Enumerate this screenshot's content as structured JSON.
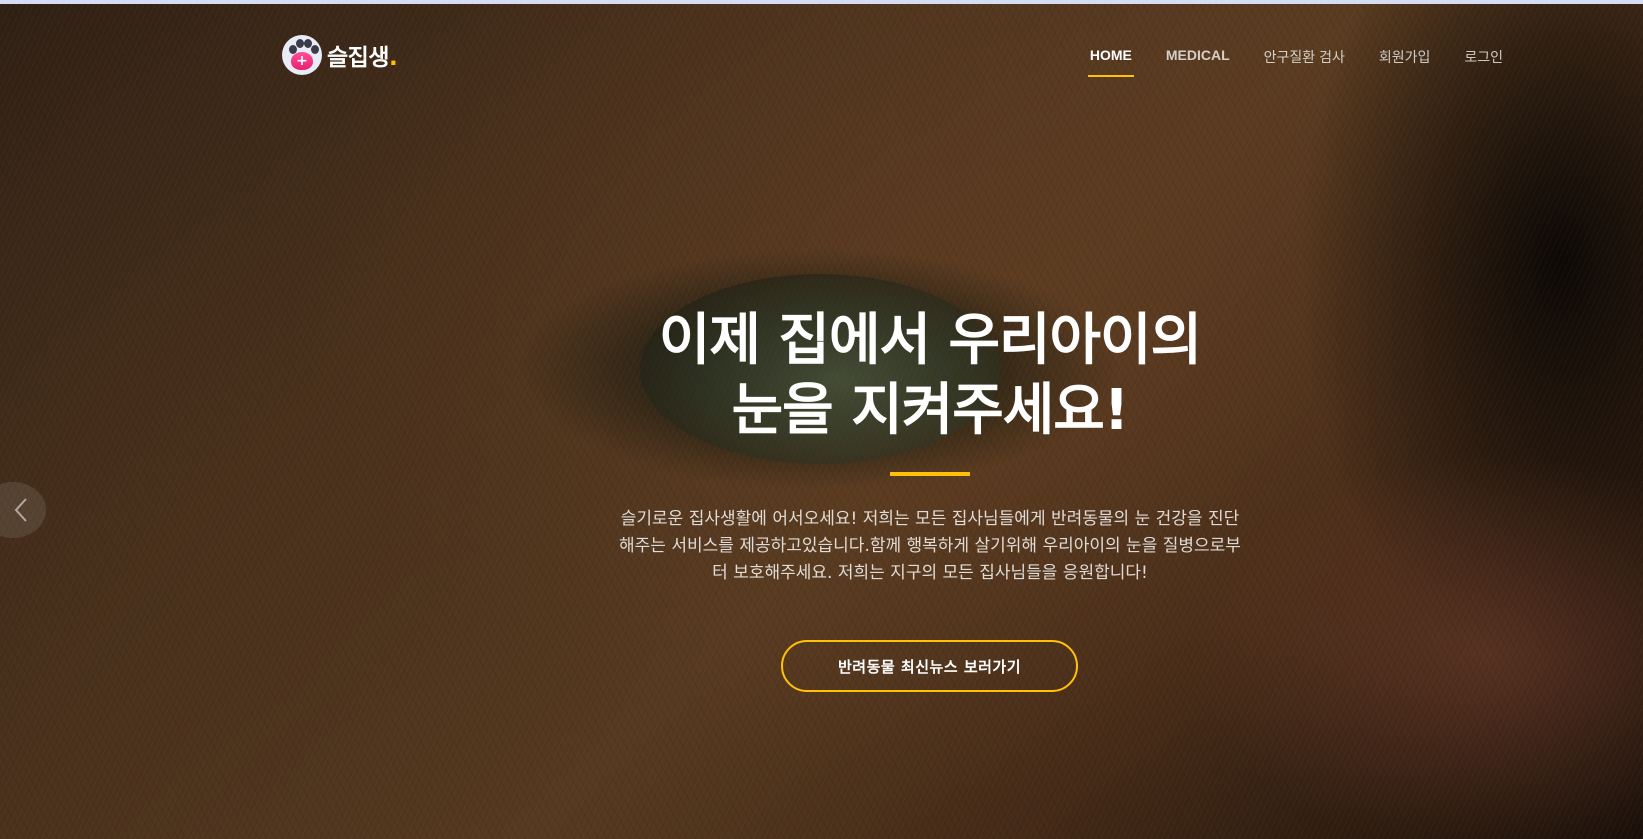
{
  "brand": {
    "name": "슬집생",
    "dot": ".",
    "accent_color": "#ffc107",
    "logo_icon": "paw-medical-icon"
  },
  "nav": {
    "items": [
      {
        "label": "HOME",
        "active": true
      },
      {
        "label": "MEDICAL",
        "active": false
      },
      {
        "label": "안구질환 검사",
        "active": false
      },
      {
        "label": "회원가입",
        "active": false
      },
      {
        "label": "로그인",
        "active": false
      }
    ]
  },
  "hero": {
    "title_line1": "이제 집에서 우리아이의",
    "title_line2": "눈을 지켜주세요!",
    "description": "슬기로운 집사생활에 어서오세요! 저희는 모든 집사님들에게 반려동물의 눈 건강을 진단해주는 서비스를 제공하고있습니다.함께 행복하게 살기위해 우리아이의 눈을 질병으로부터 보호해주세요. 저희는 지구의 모든 집사님들을 응원합니다!",
    "cta_label": "반려동물 최신뉴스 보러가기",
    "prev_icon": "chevron-left-icon"
  }
}
